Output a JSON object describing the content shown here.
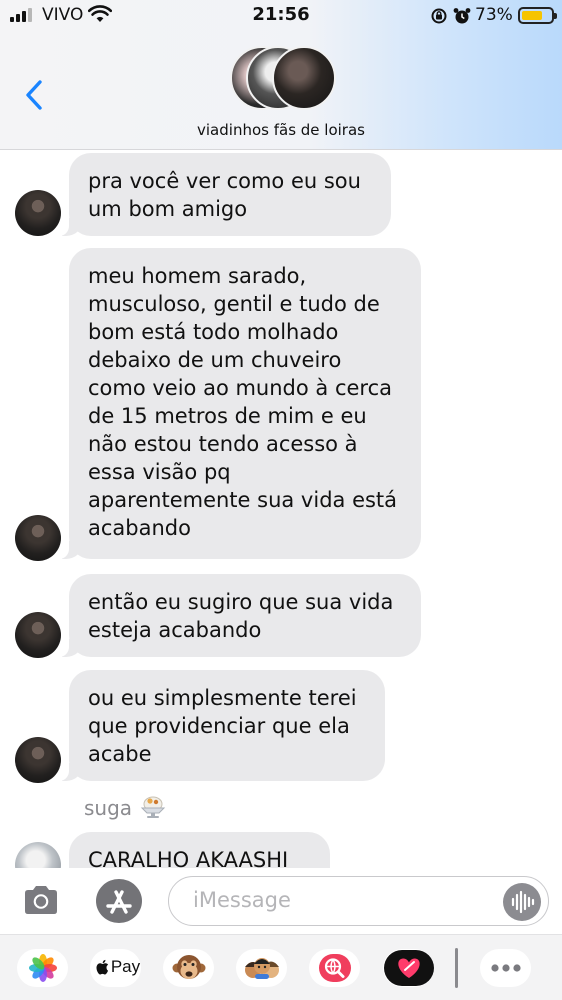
{
  "status_bar": {
    "carrier": "VIVO",
    "time": "21:56",
    "battery": "73%",
    "battery_level": 0.73
  },
  "header": {
    "group_name": "viadinhos fãs de loiras",
    "icons": {
      "back": "chevron-left-icon"
    }
  },
  "messages": [
    {
      "sender_avatar": "avatar-dark",
      "lines": [
        "pra você ver como eu sou",
        "um bom amigo"
      ]
    },
    {
      "sender_avatar": "avatar-dark",
      "lines": [
        "meu homem sarado,",
        "musculoso, gentil e tudo de",
        "bom está todo molhado",
        "debaixo de um chuveiro",
        "como veio ao mundo à cerca",
        "de 15 metros de mim e eu",
        "não estou tendo acesso à",
        "essa visão pq",
        "aparentemente sua vida está",
        "acabando"
      ]
    },
    {
      "sender_avatar": "avatar-dark",
      "lines": [
        "então eu sugiro que sua vida",
        "esteja acabando"
      ]
    },
    {
      "sender_avatar": "avatar-dark",
      "lines": [
        "ou eu simplesmente terei",
        "que providenciar que ela",
        "acabe"
      ]
    },
    {
      "sender_name": "suga",
      "sender_emoji": "shaved-ice-icon",
      "sender_avatar": "avatar-light",
      "lines": [
        "CARALHO AKAASHI"
      ]
    }
  ],
  "compose": {
    "placeholder": "iMessage",
    "icons": [
      "camera-icon",
      "app-store-icon",
      "audio-waveform-icon"
    ]
  },
  "app_drawer": {
    "items": [
      "photos-icon",
      "apple-pay-icon",
      "monkey-memoji-icon",
      "memoji-stickers-icon",
      "globe-search-icon",
      "heart-digital-touch-icon",
      "more-icon"
    ],
    "apple_pay_label": "Pay"
  },
  "colors": {
    "accent": "#1a84ff",
    "bubble_gray": "#e9e9eb",
    "battery_yellow": "#f6c400"
  }
}
